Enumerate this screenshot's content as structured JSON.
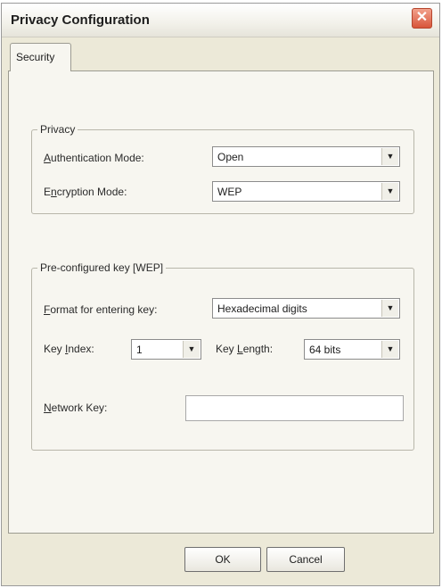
{
  "window": {
    "title": "Privacy Configuration",
    "close_symbol": "✕"
  },
  "tabs": [
    {
      "label": "Security",
      "selected": true
    }
  ],
  "privacy_group": {
    "legend": "Privacy",
    "authentication": {
      "label_prefix": "",
      "label_underlined": "A",
      "label_rest": "uthentication Mode:",
      "value": "Open"
    },
    "encryption": {
      "label_prefix": "E",
      "label_underlined": "n",
      "label_rest": "cryption Mode:",
      "value": "WEP"
    }
  },
  "key_group": {
    "legend": "Pre-configured key [WEP]",
    "format": {
      "label_prefix": "",
      "label_underlined": "F",
      "label_rest": "ormat for entering key:",
      "value": "Hexadecimal digits"
    },
    "key_index": {
      "label_prefix": "Key ",
      "label_underlined": "I",
      "label_rest": "ndex:",
      "value": "1"
    },
    "key_length": {
      "label_prefix": "Key ",
      "label_underlined": "L",
      "label_rest": "ength:",
      "value": "64 bits"
    },
    "network_key": {
      "label_prefix": "",
      "label_underlined": "N",
      "label_rest": "etwork Key:",
      "value": ""
    }
  },
  "buttons": {
    "ok": "OK",
    "cancel": "Cancel"
  },
  "icons": {
    "dropdown": "▼"
  }
}
